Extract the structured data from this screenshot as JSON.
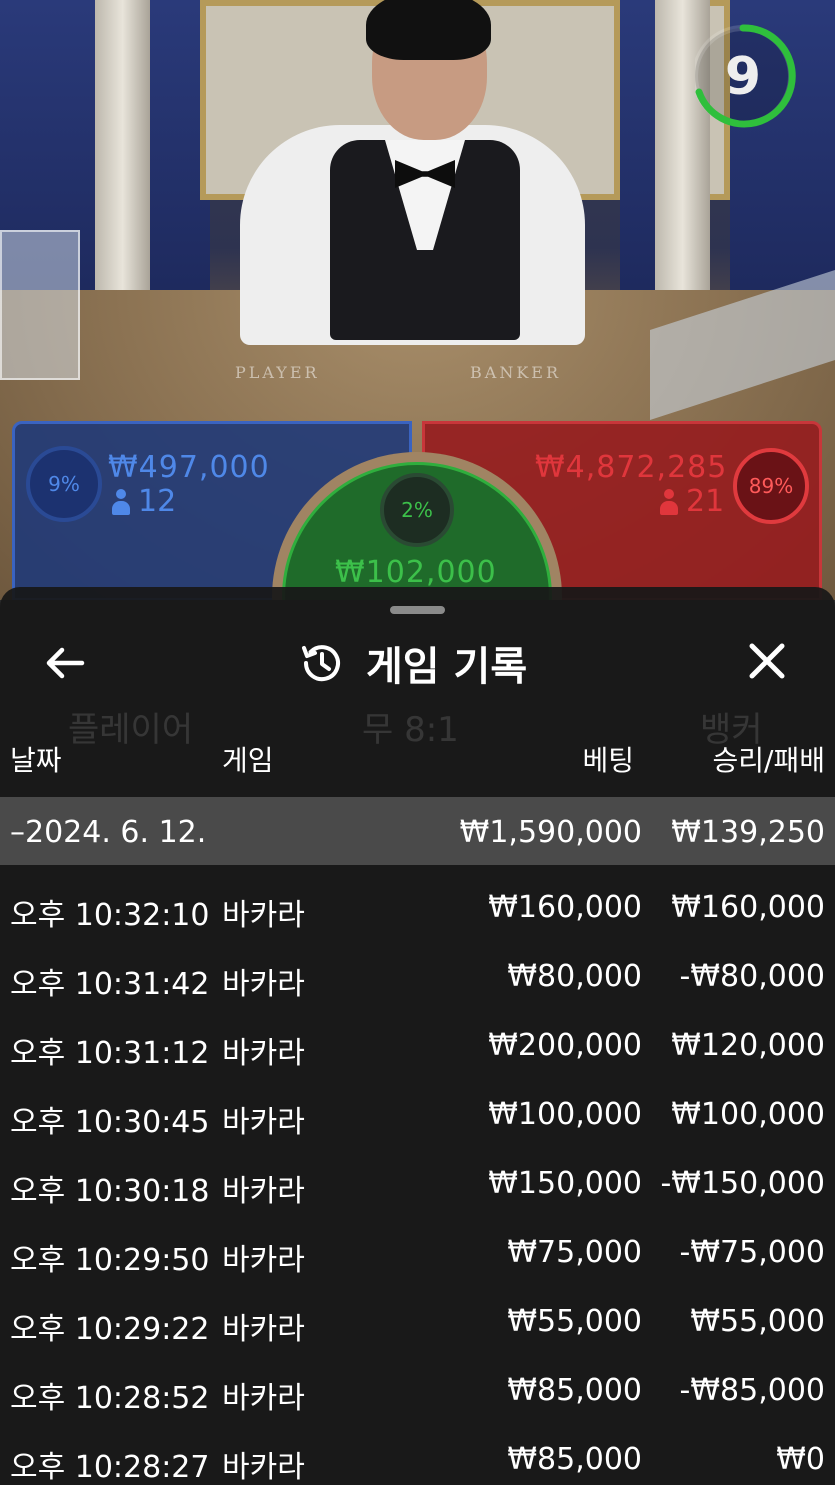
{
  "timer": {
    "seconds": "9"
  },
  "bets": {
    "player": {
      "percent": "9%",
      "amount": "₩497,000",
      "players": "12"
    },
    "tie": {
      "percent": "2%",
      "amount": "₩102,000"
    },
    "banker": {
      "percent": "89%",
      "amount": "₩4,872,285",
      "players": "21"
    }
  },
  "scene_labels": {
    "player": "PLAYER",
    "banker": "BANKER"
  },
  "background_labels": {
    "player": "플레이어",
    "tie": "무 8:1",
    "banker": "뱅커"
  },
  "history": {
    "title": "게임 기록",
    "columns": {
      "date": "날짜",
      "game": "게임",
      "bet": "베팅",
      "win_loss": "승리/패배"
    },
    "day": {
      "label": "–2024. 6. 12.",
      "total_bet": "₩1,590,000",
      "total_win_loss": "₩139,250"
    },
    "rows": [
      {
        "time": "오후 10:32:10",
        "game": "바카라",
        "bet": "₩160,000",
        "win_loss": "₩160,000"
      },
      {
        "time": "오후 10:31:42",
        "game": "바카라",
        "bet": "₩80,000",
        "win_loss": "-₩80,000"
      },
      {
        "time": "오후 10:31:12",
        "game": "바카라",
        "bet": "₩200,000",
        "win_loss": "₩120,000"
      },
      {
        "time": "오후 10:30:45",
        "game": "바카라",
        "bet": "₩100,000",
        "win_loss": "₩100,000"
      },
      {
        "time": "오후 10:30:18",
        "game": "바카라",
        "bet": "₩150,000",
        "win_loss": "-₩150,000"
      },
      {
        "time": "오후 10:29:50",
        "game": "바카라",
        "bet": "₩75,000",
        "win_loss": "-₩75,000"
      },
      {
        "time": "오후 10:29:22",
        "game": "바카라",
        "bet": "₩55,000",
        "win_loss": "₩55,000"
      },
      {
        "time": "오후 10:28:52",
        "game": "바카라",
        "bet": "₩85,000",
        "win_loss": "-₩85,000"
      },
      {
        "time": "오후 10:28:27",
        "game": "바카라",
        "bet": "₩85,000",
        "win_loss": "₩0"
      }
    ]
  },
  "icons": {
    "back": "arrow-left-icon",
    "history": "history-icon",
    "close": "close-icon",
    "person": "person-icon"
  },
  "colors": {
    "player": "#4f88e8",
    "banker": "#e0363c",
    "tie": "#3cc04a",
    "timer": "#2fbf3c"
  }
}
